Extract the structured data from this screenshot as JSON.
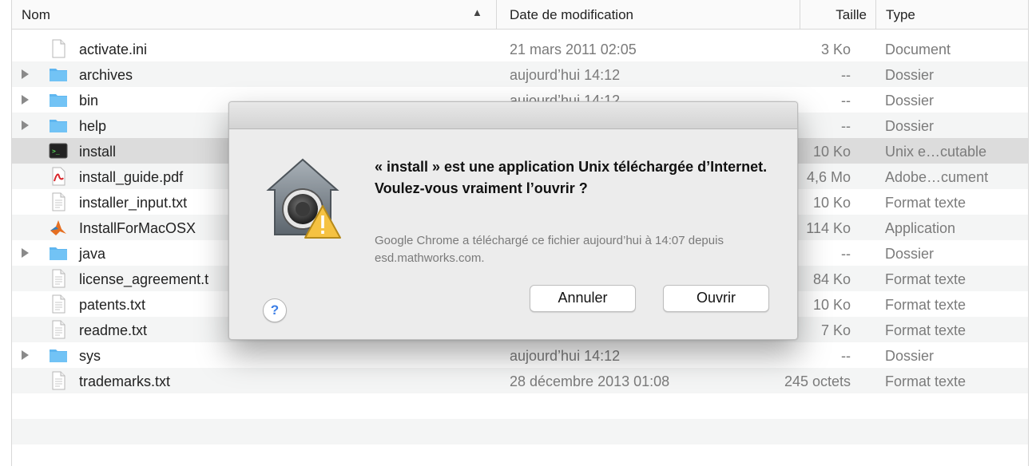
{
  "columns": {
    "name": "Nom",
    "date": "Date de modification",
    "size": "Taille",
    "type": "Type"
  },
  "files": [
    {
      "name": "activate.ini",
      "date": "21 mars 2011 02:05",
      "size": "3 Ko",
      "type": "Document",
      "icon": "document-icon",
      "folder": false
    },
    {
      "name": "archives",
      "date": "aujourd’hui 14:12",
      "size": "--",
      "type": "Dossier",
      "icon": "folder-icon",
      "folder": true
    },
    {
      "name": "bin",
      "date": "aujourd’hui 14:12",
      "size": "--",
      "type": "Dossier",
      "icon": "folder-icon",
      "folder": true
    },
    {
      "name": "help",
      "date": "",
      "size": "--",
      "type": "Dossier",
      "icon": "folder-icon",
      "folder": true
    },
    {
      "name": "install",
      "date": "",
      "size": "10 Ko",
      "type": "Unix e…cutable",
      "icon": "terminal-icon",
      "folder": false,
      "selected": true
    },
    {
      "name": "install_guide.pdf",
      "date": "",
      "size": "4,6 Mo",
      "type": "Adobe…cument",
      "icon": "pdf-icon",
      "folder": false
    },
    {
      "name": "installer_input.txt",
      "date": "",
      "size": "10 Ko",
      "type": "Format texte",
      "icon": "text-file-icon",
      "folder": false
    },
    {
      "name": "InstallForMacOSX",
      "date": "",
      "size": "114 Ko",
      "type": "Application",
      "icon": "matlab-icon",
      "folder": false
    },
    {
      "name": "java",
      "date": "",
      "size": "--",
      "type": "Dossier",
      "icon": "folder-icon",
      "folder": true
    },
    {
      "name": "license_agreement.t",
      "date": "",
      "size": "84 Ko",
      "type": "Format texte",
      "icon": "text-file-icon",
      "folder": false
    },
    {
      "name": "patents.txt",
      "date": "",
      "size": "10 Ko",
      "type": "Format texte",
      "icon": "text-file-icon",
      "folder": false
    },
    {
      "name": "readme.txt",
      "date": "",
      "size": "7 Ko",
      "type": "Format texte",
      "icon": "text-file-icon",
      "folder": false
    },
    {
      "name": "sys",
      "date": "aujourd’hui 14:12",
      "size": "--",
      "type": "Dossier",
      "icon": "folder-icon",
      "folder": true
    },
    {
      "name": "trademarks.txt",
      "date": "28 décembre 2013 01:08",
      "size": "245 octets",
      "type": "Format texte",
      "icon": "text-file-icon",
      "folder": false
    }
  ],
  "dialog": {
    "title": "« install » est une application Unix téléchargée d’Internet. Voulez-vous vraiment l’ouvrir ?",
    "message": "Google Chrome a téléchargé ce fichier aujourd’hui à 14:07 depuis esd.mathworks.com.",
    "cancel_label": "Annuler",
    "open_label": "Ouvrir",
    "help_label": "?"
  },
  "colors": {
    "folder": "#5fb6f0",
    "warning": "#f5c242",
    "help_blue": "#3b7ee6",
    "selected_row": "#dcdcdc"
  }
}
